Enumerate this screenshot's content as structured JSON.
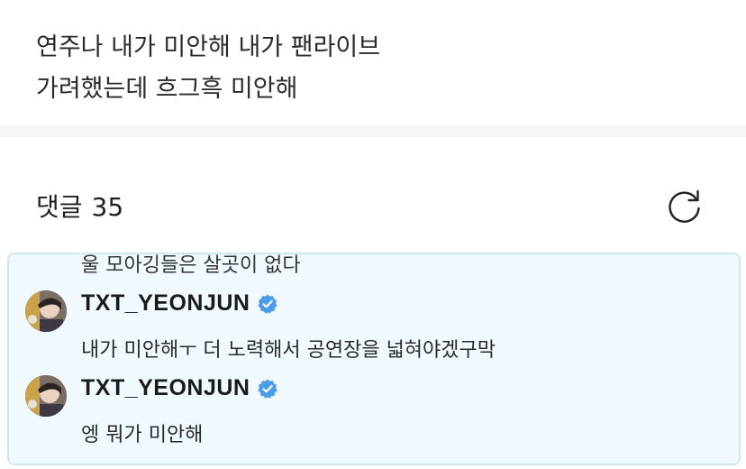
{
  "post": {
    "lines": [
      "연주나 내가 미안해 내가 팬라이브",
      "가려했는데 흐그흑 미안해"
    ]
  },
  "comments_header": {
    "label": "댓글",
    "count": "35",
    "refresh_icon": "refresh-icon"
  },
  "comments": {
    "clipped_previous_text": "울 모아깅들은 살곳이 없다",
    "items": [
      {
        "author": "TXT_YEONJUN",
        "verified": true,
        "text": "내가 미안해ㅜ 더 노력해서 공연장을 넓혀야겠구막"
      },
      {
        "author": "TXT_YEONJUN",
        "verified": true,
        "text": "엥 뭐가 미안해"
      }
    ]
  },
  "colors": {
    "highlight_background": "#f0f9fd",
    "highlight_border": "#cfe6f0",
    "verified_badge": "#4a9be8"
  }
}
